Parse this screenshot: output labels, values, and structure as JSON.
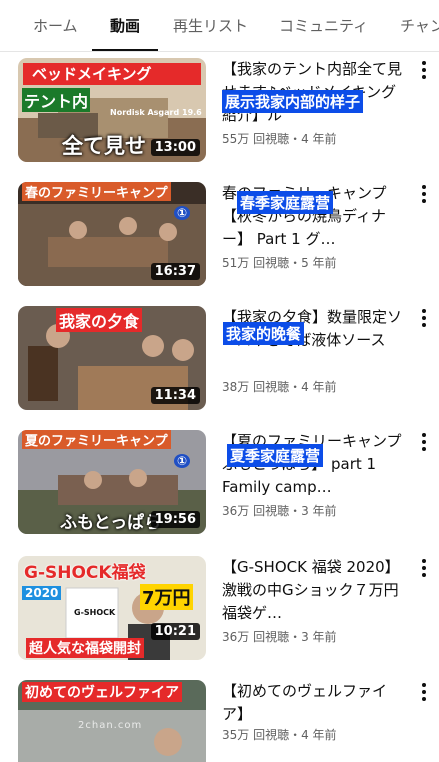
{
  "tabs": [
    {
      "label": "ホーム",
      "active": false
    },
    {
      "label": "動画",
      "active": true
    },
    {
      "label": "再生リスト",
      "active": false
    },
    {
      "label": "コミュニティ",
      "active": false
    },
    {
      "label": "チャン",
      "active": false
    }
  ],
  "videos": [
    {
      "title": "【我家のテント内部全て見せます♪ベッドメイキング紹介】ル",
      "overlay": "展示我家内部的样子",
      "views": "55万 回視聴",
      "age": "4 年前",
      "duration": "13:00",
      "thumb_texts": [
        "ベッドメイキング",
        "テント内",
        "全て見せ",
        "Nordisk Asgard 19.6"
      ]
    },
    {
      "title": "春のファミリーキャンプ【秋冬からの焼鳥ディナー】 Part 1 グ…",
      "overlay": "春季家庭露营",
      "views": "51万 回視聴",
      "age": "5 年前",
      "duration": "16:37",
      "thumb_texts": [
        "春のファミリーキャンプ",
        "①"
      ]
    },
    {
      "title": "【我家の夕食】数量限定ソースやきそば液体ソース",
      "overlay": "我家的晚餐",
      "views": "38万 回視聴",
      "age": "4 年前",
      "duration": "11:34",
      "thumb_texts": [
        "我家の夕食"
      ]
    },
    {
      "title": "【夏のファミリーキャンプ ふもとっぱら】 part 1 Family camp…",
      "overlay": "夏季家庭露营",
      "views": "36万 回視聴",
      "age": "3 年前",
      "duration": "19:56",
      "thumb_texts": [
        "夏のファミリーキャンプ",
        "①",
        "ふもとっぱら"
      ]
    },
    {
      "title": "【G-SHOCK 福袋 2020】激戦の中Gショック７万円福袋ゲ…",
      "overlay": "",
      "views": "36万 回視聴",
      "age": "3 年前",
      "duration": "10:21",
      "thumb_texts": [
        "G-SHOCK福袋",
        "2020",
        "7万円",
        "超人気な福袋開封",
        "G-SHOCK"
      ]
    },
    {
      "title": "【初めてのヴェルファイア】",
      "overlay": "",
      "views": "35万 回視聴",
      "age": "4 年前",
      "duration": "",
      "thumb_texts": [
        "初めてのヴェルファイア"
      ]
    }
  ],
  "separator": "・",
  "watermark": "2chan.com"
}
